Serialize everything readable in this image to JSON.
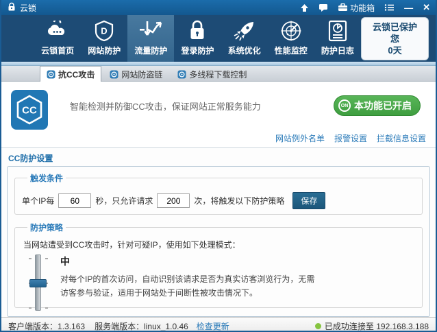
{
  "titlebar": {
    "app_name": "云锁",
    "toolbox_label": "功能箱",
    "minimize_glyph": "—",
    "close_glyph": "✕"
  },
  "nav": {
    "items": [
      {
        "label": "云锁首页"
      },
      {
        "label": "网站防护"
      },
      {
        "label": "流量防护"
      },
      {
        "label": "登录防护"
      },
      {
        "label": "系统优化"
      },
      {
        "label": "性能监控"
      },
      {
        "label": "防护日志"
      }
    ],
    "protect_badge_line1": "云锁已保护您",
    "protect_badge_line2": "0天"
  },
  "tabs": [
    {
      "label": "抗CC攻击"
    },
    {
      "label": "网站防盗链"
    },
    {
      "label": "多线程下载控制"
    }
  ],
  "feature": {
    "icon_text": "CC",
    "description": "智能检测并防御CC攻击，保证网站正常服务能力",
    "status_on_glyph": "ON",
    "status_button": "本功能已开启",
    "links": [
      {
        "label": "网站例外名单"
      },
      {
        "label": "报警设置"
      },
      {
        "label": "拦截信息设置"
      }
    ]
  },
  "settings": {
    "section_title": "CC防护设置",
    "trigger": {
      "legend": "触发条件",
      "label_part1": "单个IP每",
      "seconds_value": "60",
      "label_part2": "秒，只允许请求",
      "requests_value": "200",
      "label_part3": "次，将触发以下防护策略",
      "save_button": "保存"
    },
    "strategy": {
      "legend": "防护策略",
      "intro": "当网站遭受到CC攻击时，针对可疑IP，使用如下处理模式：",
      "level": "中",
      "description_line1": "对每个IP的首次访问，自动识别该请求是否为真实访客浏览行为，无需",
      "description_line2": "访客参与验证，适用于网站处于间断性被攻击情况下。"
    }
  },
  "statusbar": {
    "client_version_label": "客户端版本：",
    "client_version": "1.3.163",
    "server_version_label": "服务端版本：",
    "server_version": "linux_1.0.46",
    "check_update": "检查更新",
    "connection": "已成功连接至 192.168.3.188"
  },
  "colors": {
    "titlebar_blue": "#1b6cab",
    "nav_navy": "#1d4b75",
    "nav_active": "#48799f",
    "accent_blue": "#2b7bb9",
    "enabled_green": "#3f9e40",
    "save_button_blue": "#1c567a",
    "connected_dot_green": "#86c440"
  }
}
